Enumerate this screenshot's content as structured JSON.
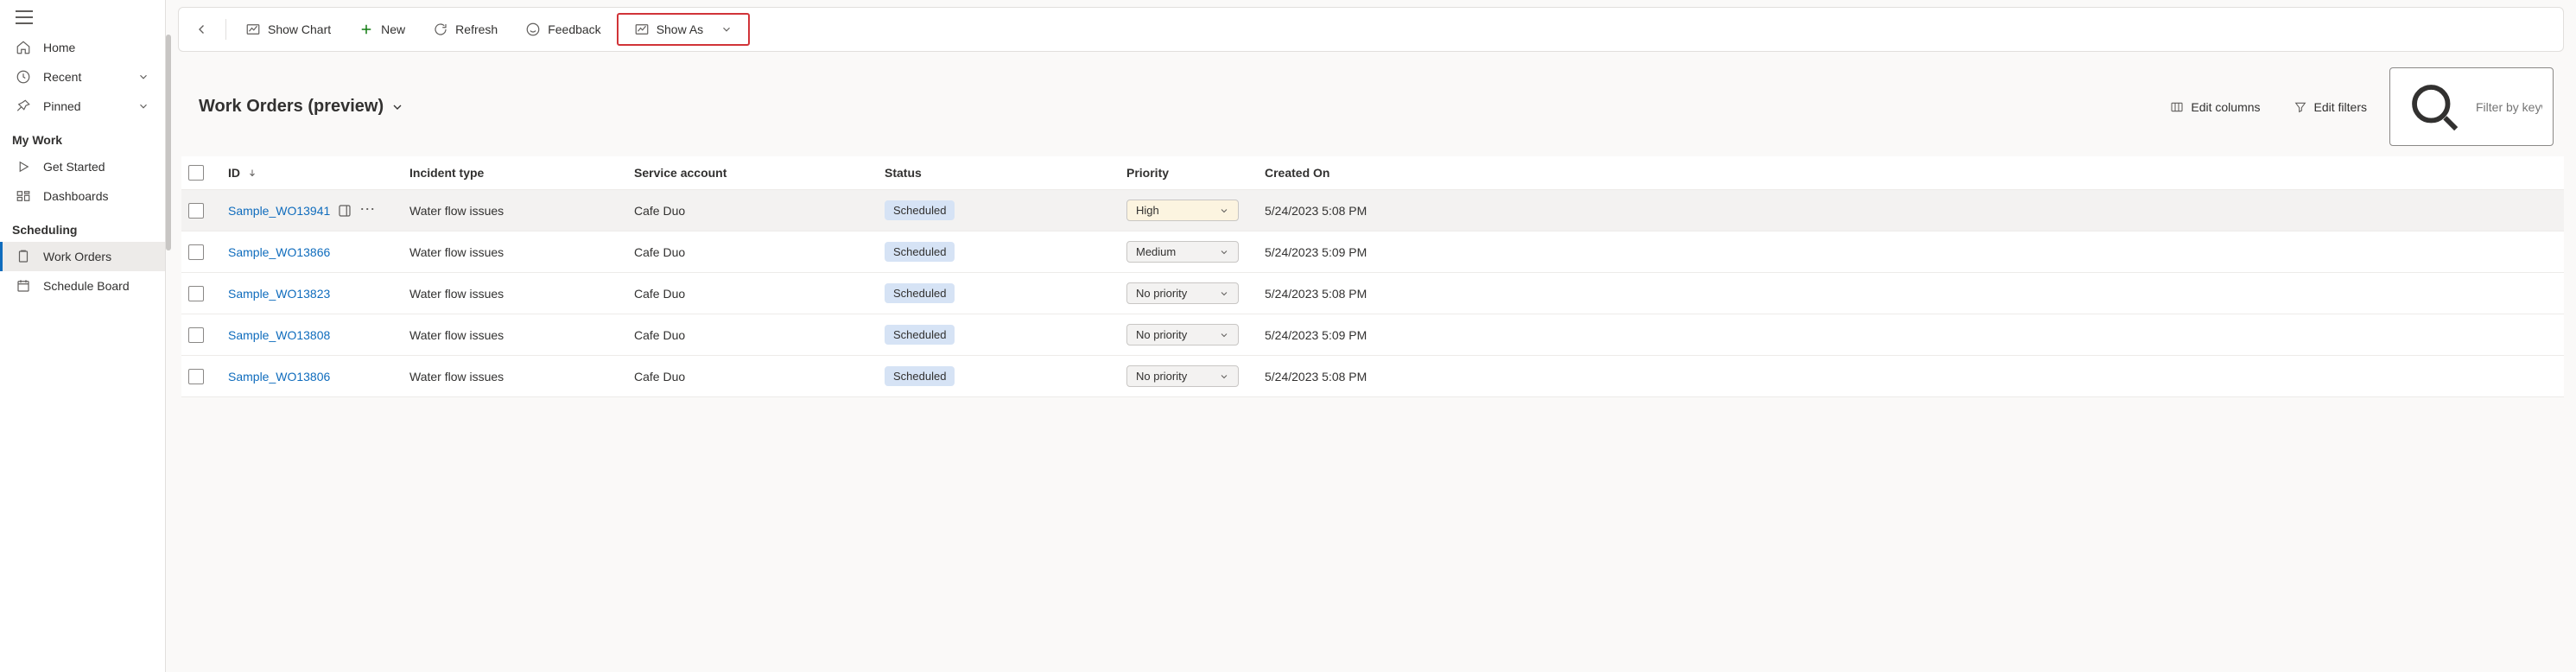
{
  "nav": {
    "home": "Home",
    "recent": "Recent",
    "pinned": "Pinned",
    "section_mywork": "My Work",
    "get_started": "Get Started",
    "dashboards": "Dashboards",
    "section_scheduling": "Scheduling",
    "work_orders": "Work Orders",
    "schedule_board": "Schedule Board"
  },
  "commandbar": {
    "show_chart": "Show Chart",
    "new": "New",
    "refresh": "Refresh",
    "feedback": "Feedback",
    "show_as": "Show As"
  },
  "view": {
    "title": "Work Orders (preview)",
    "edit_columns": "Edit columns",
    "edit_filters": "Edit filters",
    "filter_placeholder": "Filter by keyword"
  },
  "columns": {
    "id": "ID",
    "incident_type": "Incident type",
    "service_account": "Service account",
    "status": "Status",
    "priority": "Priority",
    "created_on": "Created On"
  },
  "rows": [
    {
      "id": "Sample_WO13941",
      "incident": "Water flow issues",
      "account": "Cafe Duo",
      "status": "Scheduled",
      "priority": "High",
      "priority_kind": "high",
      "created": "5/24/2023 5:08 PM",
      "hover": true
    },
    {
      "id": "Sample_WO13866",
      "incident": "Water flow issues",
      "account": "Cafe Duo",
      "status": "Scheduled",
      "priority": "Medium",
      "priority_kind": "normal",
      "created": "5/24/2023 5:09 PM",
      "hover": false
    },
    {
      "id": "Sample_WO13823",
      "incident": "Water flow issues",
      "account": "Cafe Duo",
      "status": "Scheduled",
      "priority": "No priority",
      "priority_kind": "normal",
      "created": "5/24/2023 5:08 PM",
      "hover": false
    },
    {
      "id": "Sample_WO13808",
      "incident": "Water flow issues",
      "account": "Cafe Duo",
      "status": "Scheduled",
      "priority": "No priority",
      "priority_kind": "normal",
      "created": "5/24/2023 5:09 PM",
      "hover": false
    },
    {
      "id": "Sample_WO13806",
      "incident": "Water flow issues",
      "account": "Cafe Duo",
      "status": "Scheduled",
      "priority": "No priority",
      "priority_kind": "normal",
      "created": "5/24/2023 5:08 PM",
      "hover": false
    }
  ]
}
